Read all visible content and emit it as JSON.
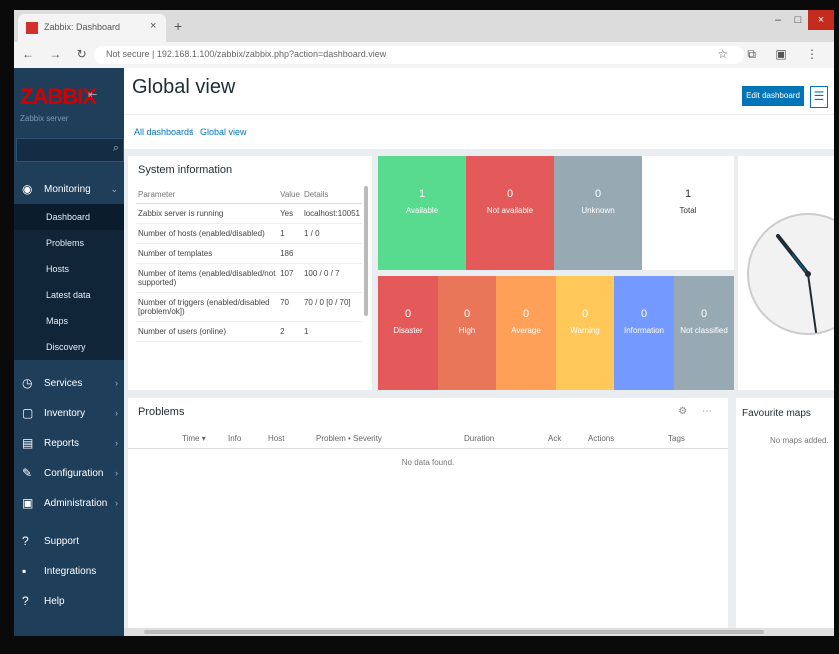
{
  "browser": {
    "tab_title": "Zabbix: Dashboard",
    "tab_close": "×",
    "new_tab": "+",
    "address_text": "Not secure | 192.168.1.100/zabbix/zabbix.php?action=dashboard.view",
    "nav_glyphs": "← → ↻",
    "tool_glyphs": "☆ ⧉ ▣ ⋮",
    "win_min": "–",
    "win_max": "□",
    "win_close": "×"
  },
  "sidebar": {
    "logo": "ZABBIX",
    "collapse": "⇤",
    "server": "Zabbix server",
    "search_icon": "⌕",
    "items": [
      {
        "label": "Monitoring",
        "icon": "◉",
        "arrow": "⌄"
      },
      {
        "label": "Inventory",
        "icon": "▢",
        "arrow": "›"
      },
      {
        "label": "Reports",
        "icon": "▤",
        "arrow": "›"
      },
      {
        "label": "Configuration",
        "icon": "✎",
        "arrow": "›"
      },
      {
        "label": "Administration",
        "icon": "▣",
        "arrow": "›"
      },
      {
        "label": "Support",
        "icon": "?",
        "arrow": ""
      },
      {
        "label": "Integrations",
        "icon": "▪",
        "arrow": ""
      },
      {
        "label": "Help",
        "icon": "?",
        "arrow": ""
      }
    ],
    "submenu": [
      {
        "label": "Dashboard"
      },
      {
        "label": "Problems"
      },
      {
        "label": "Hosts"
      },
      {
        "label": "Latest data"
      },
      {
        "label": "Maps"
      },
      {
        "label": "Discovery"
      }
    ],
    "services_label": "Services"
  },
  "header": {
    "title": "Global view",
    "edit_button": "Edit dashboard",
    "kebab": "☰"
  },
  "breadcrumbs": [
    "All dashboards",
    "/",
    "Global view"
  ],
  "system_info": {
    "title": "System information",
    "columns": [
      "Parameter",
      "Value",
      "Details"
    ],
    "rows": [
      [
        "Zabbix server is running",
        "Yes",
        "localhost:10051"
      ],
      [
        "Number of hosts (enabled/disabled)",
        "1",
        "1 / 0"
      ],
      [
        "Number of templates",
        "186",
        ""
      ],
      [
        "Number of items (enabled/disabled/not supported)",
        "107",
        "100 / 0 / 7"
      ],
      [
        "Number of triggers (enabled/disabled [problem/ok])",
        "70",
        "70 / 0 [0 / 70]"
      ],
      [
        "Number of users (online)",
        "2",
        "1"
      ]
    ]
  },
  "host_availability": [
    {
      "count": "1",
      "label": "Available",
      "color": "#59db8f"
    },
    {
      "count": "0",
      "label": "Not available",
      "color": "#e45959"
    },
    {
      "count": "0",
      "label": "Unknown",
      "color": "#97aab3"
    },
    {
      "count": "1",
      "label": "Total",
      "color": "#ffffff"
    }
  ],
  "problem_severity": [
    {
      "count": "0",
      "label": "Disaster",
      "color": "#e45959"
    },
    {
      "count": "0",
      "label": "High",
      "color": "#e97659"
    },
    {
      "count": "0",
      "label": "Average",
      "color": "#ffa059"
    },
    {
      "count": "0",
      "label": "Warning",
      "color": "#ffc859"
    },
    {
      "count": "0",
      "label": "Information",
      "color": "#7499ff"
    },
    {
      "count": "0",
      "label": "Not classified",
      "color": "#97aab3"
    }
  ],
  "problems": {
    "title": "Problems",
    "controls": "⚙ ⋯",
    "columns": [
      "Time ▾",
      "Info",
      "Host",
      "Problem • Severity",
      "Duration",
      "Ack",
      "Actions",
      "Tags"
    ],
    "empty": "No data found."
  },
  "favorite_maps": {
    "title": "Favourite maps",
    "empty": "No maps added."
  }
}
